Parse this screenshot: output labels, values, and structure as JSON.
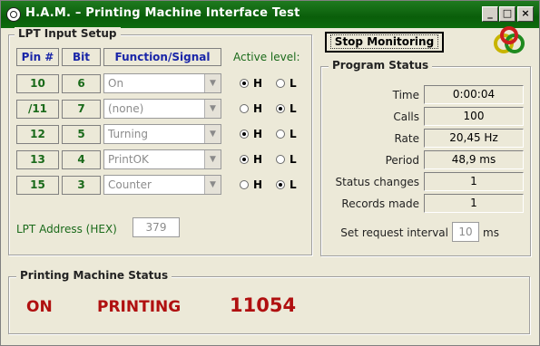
{
  "window": {
    "title": "H.A.M. – Printing Machine Interface Test",
    "buttons": {
      "minimize": "_",
      "maximize": "□",
      "close": "×"
    }
  },
  "lpt_input": {
    "group_title": "LPT Input Setup",
    "headers": {
      "pin": "Pin #",
      "bit": "Bit",
      "function": "Function/Signal"
    },
    "active_level_label": "Active level:",
    "rows": [
      {
        "pin": "10",
        "bit": "6",
        "function": "On",
        "level": "H"
      },
      {
        "pin": "/11",
        "bit": "7",
        "function": "(none)",
        "level": "L"
      },
      {
        "pin": "12",
        "bit": "5",
        "function": "Turning",
        "level": "H"
      },
      {
        "pin": "13",
        "bit": "4",
        "function": "PrintOK",
        "level": "H"
      },
      {
        "pin": "15",
        "bit": "3",
        "function": "Counter",
        "level": "L"
      }
    ],
    "level_h": "H",
    "level_l": "L",
    "address_label": "LPT Address (HEX)",
    "address_value": "379"
  },
  "stop_button": "Stop Monitoring",
  "program_status": {
    "group_title": "Program Status",
    "items": [
      {
        "label": "Time",
        "value": "0:00:04"
      },
      {
        "label": "Calls",
        "value": "100"
      },
      {
        "label": "Rate",
        "value": "20,45 Hz"
      },
      {
        "label": "Period",
        "value": "48,9 ms"
      },
      {
        "label": "Status changes",
        "value": "1"
      },
      {
        "label": "Records made",
        "value": "1"
      }
    ],
    "interval_label": "Set request interval",
    "interval_value": "10",
    "interval_unit": "ms"
  },
  "machine_status": {
    "group_title": "Printing Machine Status",
    "power": "ON",
    "state": "PRINTING",
    "count": "11054"
  },
  "colors": {
    "accent_green": "#1a6a1a",
    "header_blue": "#1a26a8",
    "status_red": "#b01010",
    "titlebar": "#0a5e0a"
  }
}
